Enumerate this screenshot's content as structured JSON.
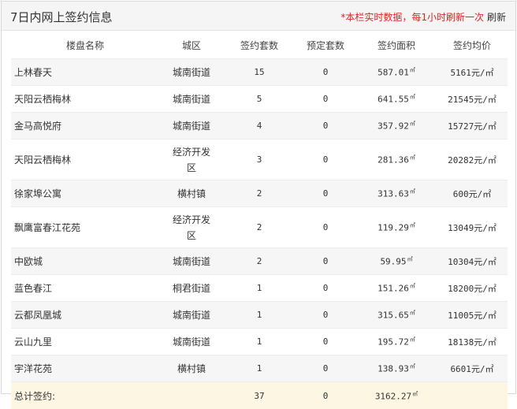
{
  "header": {
    "title": "7日内网上签约信息",
    "notice": "*本栏实时数据，每1小时刷新一次",
    "refresh_label": "刷新"
  },
  "table": {
    "columns": [
      "楼盘名称",
      "城区",
      "签约套数",
      "预定套数",
      "签约面积",
      "签约均价"
    ],
    "area_unit": "㎡",
    "price_unit": "元/㎡",
    "rows": [
      {
        "name": "上林春天",
        "district": "城南街道",
        "signed": "15",
        "reserved": "0",
        "area": "587.01",
        "price": "5161"
      },
      {
        "name": "天阳云栖梅林",
        "district": "城南街道",
        "signed": "5",
        "reserved": "0",
        "area": "641.55",
        "price": "21545"
      },
      {
        "name": "金马高悦府",
        "district": "城南街道",
        "signed": "4",
        "reserved": "0",
        "area": "357.92",
        "price": "15727"
      },
      {
        "name": "天阳云栖梅林",
        "district": "经济开发区",
        "district_line1": "经济开发",
        "district_line2": "区",
        "signed": "3",
        "reserved": "0",
        "area": "281.36",
        "price": "20282"
      },
      {
        "name": "徐家埠公寓",
        "district": "横村镇",
        "signed": "2",
        "reserved": "0",
        "area": "313.63",
        "price": "600"
      },
      {
        "name": "飘鹰富春江花苑",
        "district": "经济开发区",
        "district_line1": "经济开发",
        "district_line2": "区",
        "signed": "2",
        "reserved": "0",
        "area": "119.29",
        "price": "13049"
      },
      {
        "name": "中欧城",
        "district": "城南街道",
        "signed": "2",
        "reserved": "0",
        "area": "59.95",
        "price": "10304"
      },
      {
        "name": "蓝色春江",
        "district": "桐君街道",
        "signed": "1",
        "reserved": "0",
        "area": "151.26",
        "price": "18200"
      },
      {
        "name": "云都凤凰城",
        "district": "城南街道",
        "signed": "1",
        "reserved": "0",
        "area": "315.65",
        "price": "11005"
      },
      {
        "name": "云山九里",
        "district": "城南街道",
        "signed": "1",
        "reserved": "0",
        "area": "195.72",
        "price": "18138"
      },
      {
        "name": "宇洋花苑",
        "district": "横村镇",
        "signed": "1",
        "reserved": "0",
        "area": "138.93",
        "price": "6601"
      }
    ],
    "total": {
      "label": "总计签约:",
      "signed": "37",
      "reserved": "0",
      "area": "3162.27"
    }
  }
}
